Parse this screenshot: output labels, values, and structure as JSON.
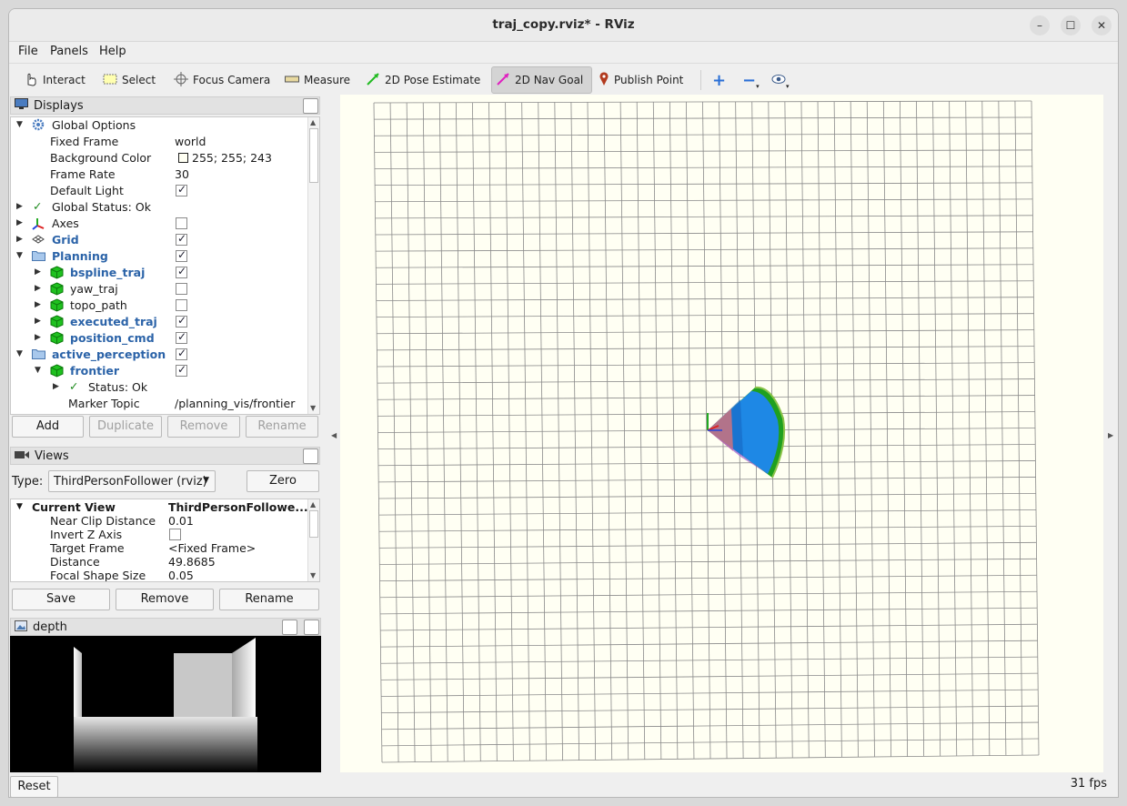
{
  "window": {
    "title": "traj_copy.rviz* - RViz"
  },
  "menubar": {
    "items": [
      "File",
      "Panels",
      "Help"
    ]
  },
  "toolbar": {
    "tools": [
      {
        "label": "Interact"
      },
      {
        "label": "Select"
      },
      {
        "label": "Focus Camera"
      },
      {
        "label": "Measure"
      },
      {
        "label": "2D Pose Estimate"
      },
      {
        "label": "2D Nav Goal",
        "active": true
      },
      {
        "label": "Publish Point"
      }
    ]
  },
  "displays": {
    "title": "Displays",
    "rows": [
      {
        "name": "Global Options",
        "value": ""
      },
      {
        "name": "Fixed Frame",
        "value": "world"
      },
      {
        "name": "Background Color",
        "value": "255; 255; 243"
      },
      {
        "name": "Frame Rate",
        "value": "30"
      },
      {
        "name": "Default Light",
        "checked": true
      },
      {
        "name": "Global Status: Ok",
        "value": ""
      },
      {
        "name": "Axes",
        "checked": false
      },
      {
        "name": "Grid",
        "checked": true
      },
      {
        "name": "Planning",
        "checked": true
      },
      {
        "name": "bspline_traj",
        "checked": true
      },
      {
        "name": "yaw_traj",
        "checked": false
      },
      {
        "name": "topo_path",
        "checked": false
      },
      {
        "name": "executed_traj",
        "checked": true
      },
      {
        "name": "position_cmd",
        "checked": true
      },
      {
        "name": "active_perception",
        "checked": true
      },
      {
        "name": "frontier",
        "checked": true
      },
      {
        "name": "Status: Ok",
        "value": ""
      },
      {
        "name": "Marker Topic",
        "value": "/planning_vis/frontier"
      }
    ],
    "buttons": {
      "add": "Add",
      "duplicate": "Duplicate",
      "remove": "Remove",
      "rename": "Rename"
    }
  },
  "views": {
    "title": "Views",
    "type_label": "Type:",
    "type_value": "ThirdPersonFollower (rviz)",
    "zero": "Zero",
    "rows": [
      {
        "name": "Current View",
        "value": "ThirdPersonFollowe..."
      },
      {
        "name": "Near Clip Distance",
        "value": "0.01"
      },
      {
        "name": "Invert Z Axis",
        "value": ""
      },
      {
        "name": "Target Frame",
        "value": "<Fixed Frame>"
      },
      {
        "name": "Distance",
        "value": "49.8685"
      },
      {
        "name": "Focal Shape Size",
        "value": "0.05"
      }
    ],
    "buttons": {
      "save": "Save",
      "remove": "Remove",
      "rename": "Rename"
    }
  },
  "depth": {
    "title": "depth"
  },
  "statusbar": {
    "reset": "Reset",
    "fps": "31 fps"
  },
  "colors": {
    "viewport_bg": "#fffff3",
    "grid_line": "#8a8a8a",
    "frustum": "#1e88e5"
  }
}
